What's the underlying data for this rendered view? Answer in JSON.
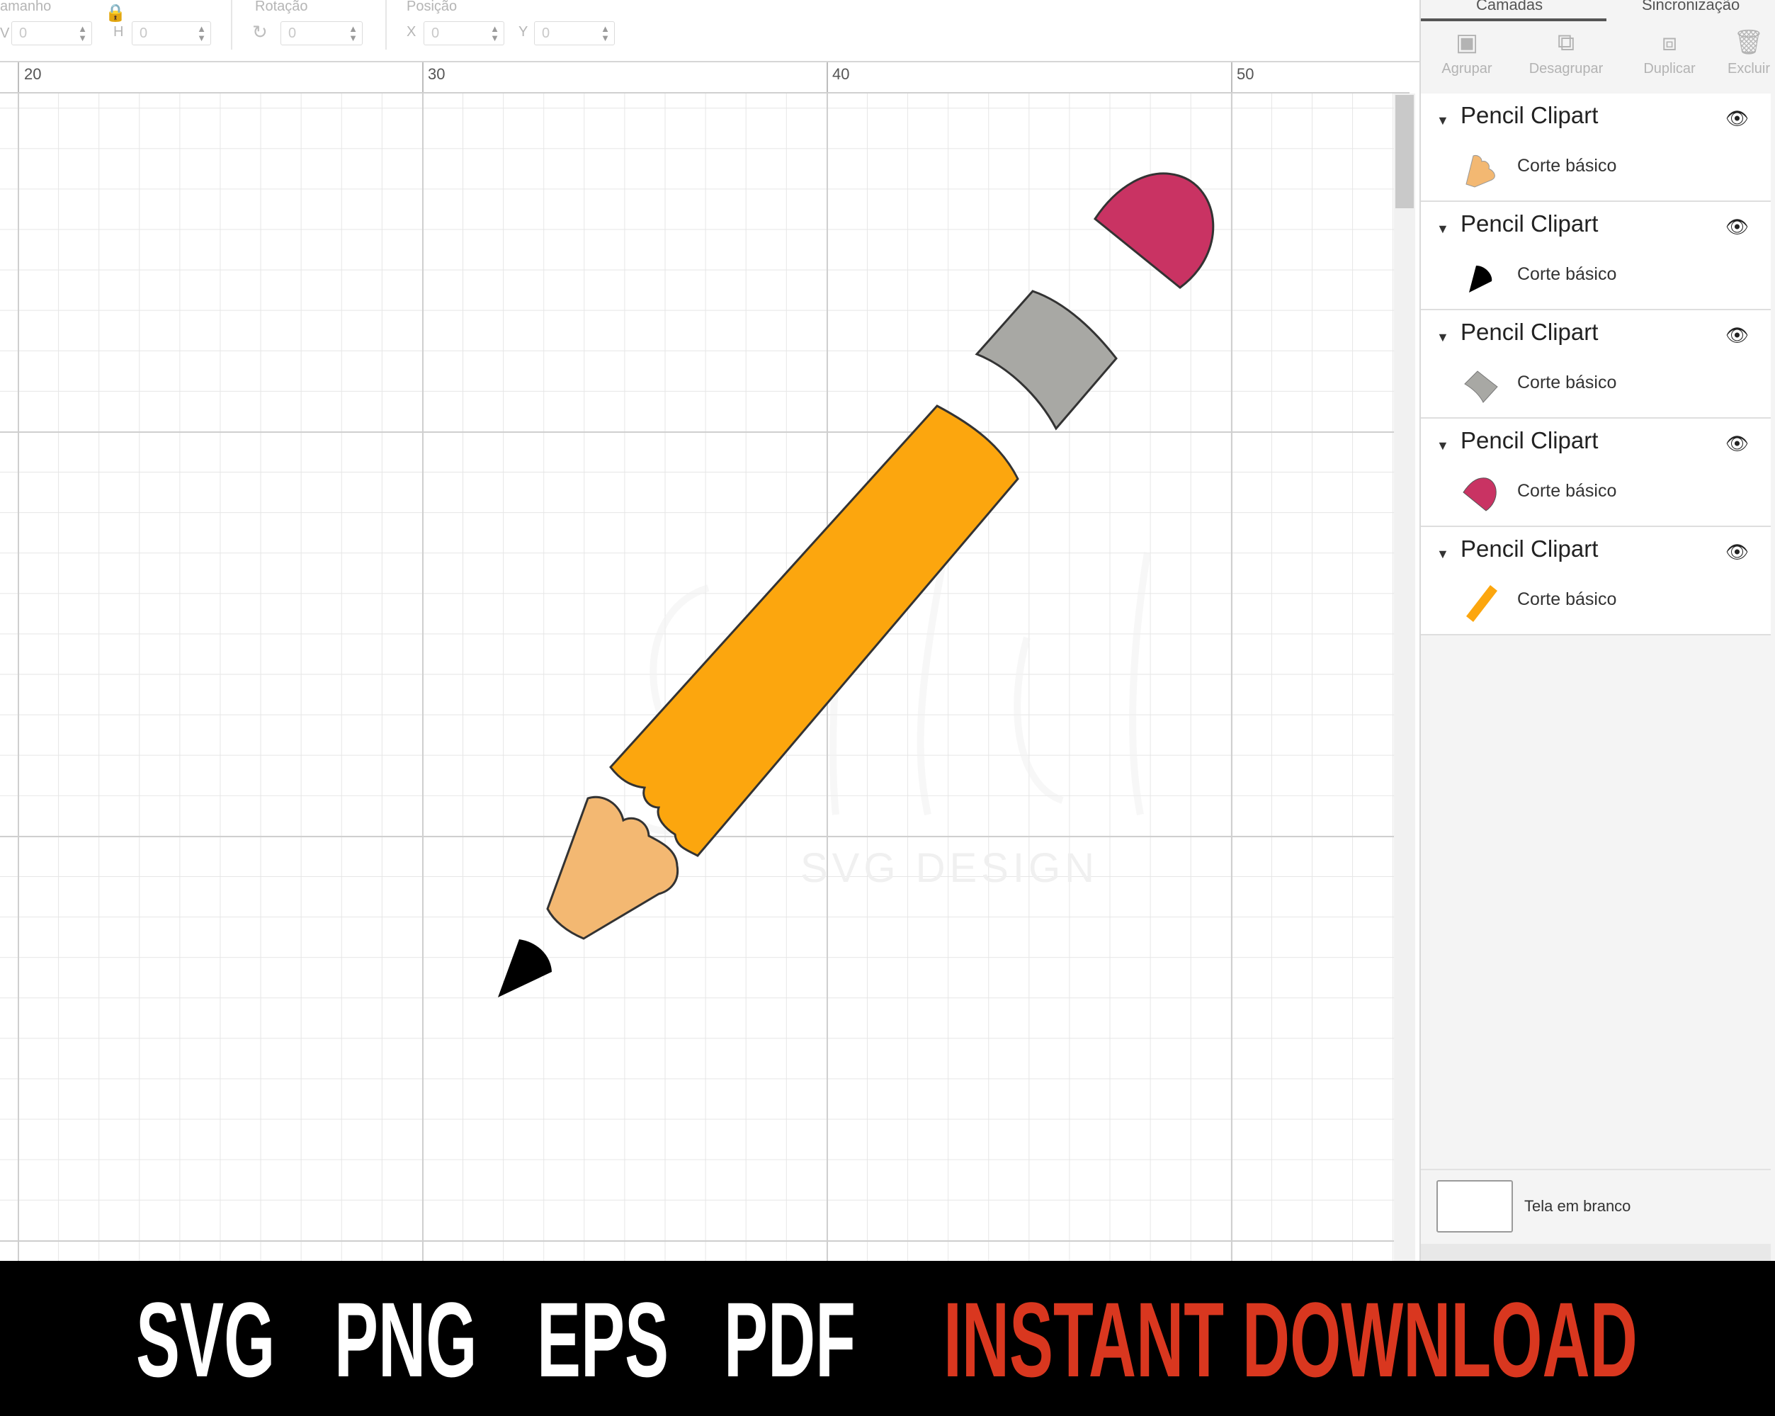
{
  "toolbar": {
    "size_label": "amanho",
    "w_axis": "V",
    "h_axis": "H",
    "w_value": "0",
    "h_value": "0",
    "rotation_label": "Rotação",
    "rotation_value": "0",
    "position_label": "Posição",
    "x_axis": "X",
    "y_axis": "Y",
    "x_value": "0",
    "y_value": "0",
    "icons": [
      "lock-icon",
      "rotate-icon"
    ]
  },
  "ruler": {
    "marks": [
      "20",
      "30",
      "40",
      "50"
    ]
  },
  "panel": {
    "tabs": [
      "Camadas",
      "Sincronização"
    ],
    "active_tab": "Camadas",
    "actions": [
      {
        "label": "Agrupar",
        "icon": "group-icon"
      },
      {
        "label": "Desagrupar",
        "icon": "ungroup-icon"
      },
      {
        "label": "Duplicar",
        "icon": "duplicate-icon"
      },
      {
        "label": "Excluir",
        "icon": "trash-icon"
      }
    ],
    "layers": [
      {
        "name": "Pencil Clipart",
        "sub": "Corte básico",
        "color": "#f3b872",
        "shape": "wood-tip"
      },
      {
        "name": "Pencil Clipart",
        "sub": "Corte básico",
        "color": "#000000",
        "shape": "graphite"
      },
      {
        "name": "Pencil Clipart",
        "sub": "Corte básico",
        "color": "#a8a8a4",
        "shape": "ferrule"
      },
      {
        "name": "Pencil Clipart",
        "sub": "Corte básico",
        "color": "#c93363",
        "shape": "eraser"
      },
      {
        "name": "Pencil Clipart",
        "sub": "Corte básico",
        "color": "#fca60e",
        "shape": "body"
      }
    ],
    "blank_canvas_label": "Tela em branco"
  },
  "canvas": {
    "watermark": "SVG DESIGN",
    "pencil_colors": {
      "eraser": "#c93363",
      "ferrule": "#a8a8a4",
      "body": "#fca60e",
      "wood": "#f3b872",
      "graphite": "#000000"
    }
  },
  "banner": {
    "formats": [
      "SVG",
      "PNG",
      "EPS",
      "PDF"
    ],
    "cta": "INSTANT DOWNLOAD",
    "cta_color": "#d9371f"
  }
}
